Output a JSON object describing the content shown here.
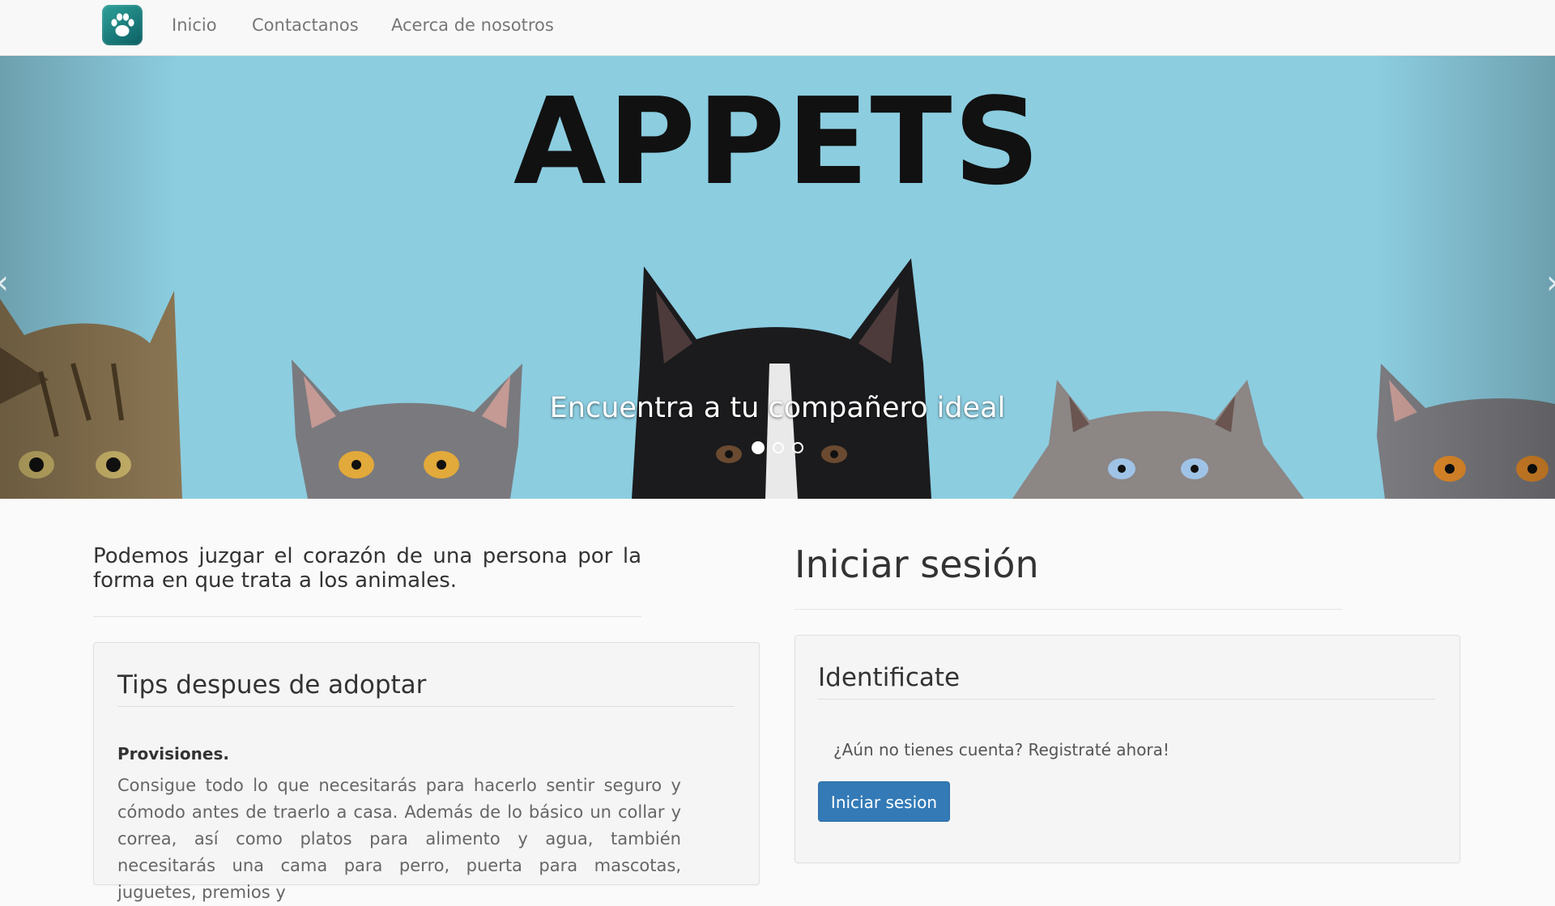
{
  "navbar": {
    "logo_icon": "paw-icon",
    "links": [
      "Inicio",
      "Contactanos",
      "Acerca de nosotros"
    ]
  },
  "hero": {
    "title": "APPETS",
    "caption": "Encuentra a tu compañero ideal",
    "slides_total": 3,
    "active_slide": 1,
    "background_color": "#8ccde0",
    "prev_icon": "chevron-left-icon",
    "next_icon": "chevron-right-icon"
  },
  "main": {
    "quote": "Podemos juzgar el corazón de una persona por la forma en que trata a los animales.",
    "tips": {
      "title": "Tips despues de adoptar",
      "subtitle": "Provisiones.",
      "body": "Consigue todo lo que necesitarás para hacerlo sentir seguro y cómodo antes de traerlo a casa. Además de lo básico un collar y correa, así como platos para alimento y agua, también necesitarás una cama para perro, puerta para mascotas, juguetes, premios y"
    },
    "login": {
      "title": "Iniciar sesión",
      "panel_title": "Identificate",
      "register_text": "¿Aún no tienes cuenta? Registraté ahora!",
      "button_label": "Iniciar sesion",
      "button_color": "#337ab7"
    }
  }
}
